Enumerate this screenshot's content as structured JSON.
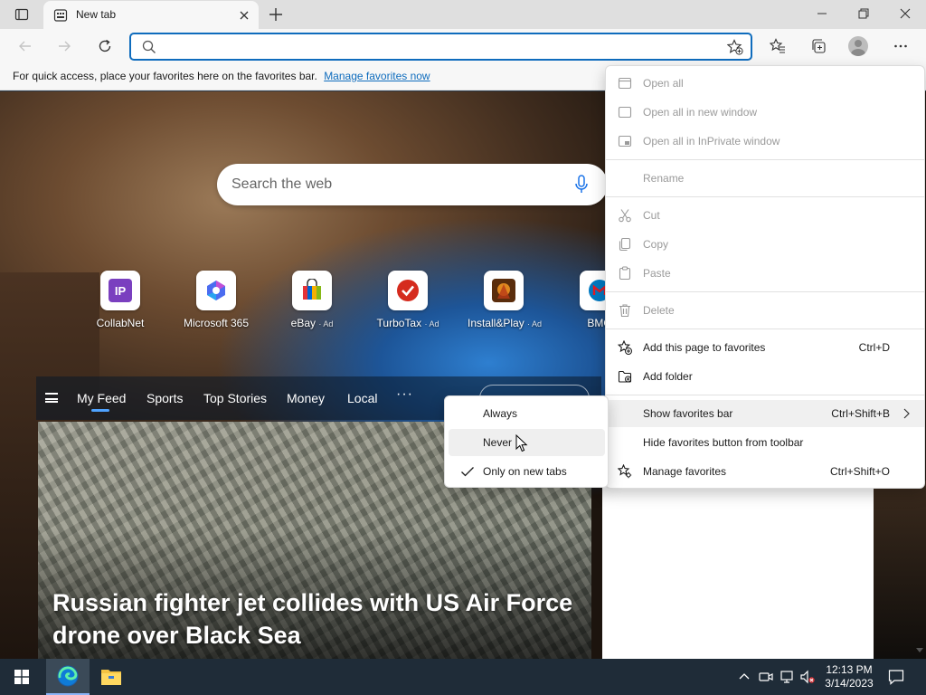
{
  "browser": {
    "tab": {
      "title": "New tab"
    },
    "address": {
      "value": "",
      "placeholder": ""
    }
  },
  "favorites_bar": {
    "message": "For quick access, place your favorites here on the favorites bar.",
    "link": "Manage favorites now"
  },
  "ntp": {
    "search_placeholder": "Search the web",
    "tiles": [
      {
        "label": "CollabNet",
        "ad": "",
        "icon": "collabnet-icon"
      },
      {
        "label": "Microsoft 365",
        "ad": "",
        "icon": "microsoft365-icon"
      },
      {
        "label": "eBay",
        "ad": "· Ad",
        "icon": "ebay-icon"
      },
      {
        "label": "TurboTax",
        "ad": "· Ad",
        "icon": "turbotax-icon"
      },
      {
        "label": "Install&Play",
        "ad": "· Ad",
        "icon": "installplay-icon"
      },
      {
        "label": "BMO",
        "ad": "",
        "icon": "bmo-icon"
      }
    ],
    "feed_tabs": [
      "My Feed",
      "Sports",
      "Top Stories",
      "Money",
      "Local"
    ],
    "feed_more": "···",
    "news": {
      "headline": "Russian fighter jet collides with US Air Force drone over Black Sea"
    }
  },
  "context_menu": {
    "items": [
      {
        "label": "Open all",
        "shortcut": "",
        "enabled": false,
        "icon": "open-all-icon"
      },
      {
        "label": "Open all in new window",
        "shortcut": "",
        "enabled": false,
        "icon": "new-window-icon"
      },
      {
        "label": "Open all in InPrivate window",
        "shortcut": "",
        "enabled": false,
        "icon": "inprivate-window-icon"
      },
      {
        "label": "Rename",
        "shortcut": "",
        "enabled": false,
        "icon": ""
      },
      {
        "label": "Cut",
        "shortcut": "",
        "enabled": false,
        "icon": "cut-icon"
      },
      {
        "label": "Copy",
        "shortcut": "",
        "enabled": false,
        "icon": "copy-icon"
      },
      {
        "label": "Paste",
        "shortcut": "",
        "enabled": false,
        "icon": "paste-icon"
      },
      {
        "label": "Delete",
        "shortcut": "",
        "enabled": false,
        "icon": "delete-icon"
      },
      {
        "label": "Add this page to favorites",
        "shortcut": "Ctrl+D",
        "enabled": true,
        "icon": "add-favorite-icon"
      },
      {
        "label": "Add folder",
        "shortcut": "",
        "enabled": true,
        "icon": "add-folder-icon"
      },
      {
        "label": "Show favorites bar",
        "shortcut": "Ctrl+Shift+B",
        "enabled": true,
        "icon": ""
      },
      {
        "label": "Hide favorites button from toolbar",
        "shortcut": "",
        "enabled": true,
        "icon": ""
      },
      {
        "label": "Manage favorites",
        "shortcut": "Ctrl+Shift+O",
        "enabled": true,
        "icon": "manage-favorites-icon"
      }
    ]
  },
  "submenu": {
    "items": [
      {
        "label": "Always",
        "checked": false
      },
      {
        "label": "Never",
        "checked": false
      },
      {
        "label": "Only on new tabs",
        "checked": true
      }
    ]
  },
  "taskbar": {
    "time": "12:13 PM",
    "date": "3/14/2023"
  },
  "colors": {
    "accent": "#0f6cbd",
    "taskbar": "#1f2c38",
    "menu_background": "#ffffff",
    "disabled_text": "#9a9a9a"
  }
}
